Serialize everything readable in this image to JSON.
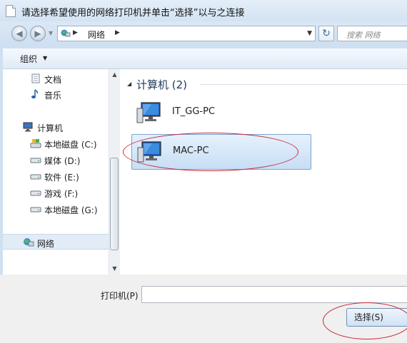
{
  "window": {
    "title": "请选择希望使用的网络打印机并单击“选择”以与之连接"
  },
  "navigation": {
    "back_icon": "back-arrow-icon",
    "forward_icon": "forward-arrow-icon",
    "address": {
      "location": "网络"
    },
    "search": {
      "placeholder": "搜索 网络"
    }
  },
  "toolbar": {
    "organize_label": "组织"
  },
  "sidebar": {
    "items": [
      {
        "label": "文档",
        "icon": "documents-icon"
      },
      {
        "label": "音乐",
        "icon": "music-icon"
      },
      {
        "label": "计算机",
        "icon": "computer-icon"
      },
      {
        "label": "本地磁盘 (C:)",
        "icon": "system-drive-icon"
      },
      {
        "label": "媒体 (D:)",
        "icon": "drive-icon"
      },
      {
        "label": "软件 (E:)",
        "icon": "drive-icon"
      },
      {
        "label": "游戏 (F:)",
        "icon": "drive-icon"
      },
      {
        "label": "本地磁盘 (G:)",
        "icon": "drive-icon"
      },
      {
        "label": "网络",
        "icon": "network-icon",
        "selected": true
      }
    ]
  },
  "content": {
    "group_title": "计算机 (2)",
    "computers": [
      {
        "name": "IT_GG-PC",
        "selected": false
      },
      {
        "name": "MAC-PC",
        "selected": true
      }
    ]
  },
  "footer": {
    "printer_label": "打印机(P)",
    "printer_value": "",
    "select_label": "选择(S)"
  },
  "colors": {
    "annotation": "#c8283c",
    "selection": "#c7def4",
    "window_frame": "#cfe0f0"
  }
}
